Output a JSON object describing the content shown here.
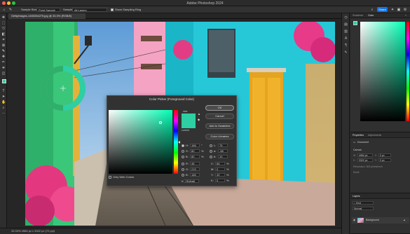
{
  "app": {
    "title": "Adobe Photoshop 2024"
  },
  "colors": {
    "foreground": "#2ecfa2",
    "accent": "#1473e6"
  },
  "options_bar": {
    "sample_size_label": "Sample Size:",
    "sample_size_value": "Point Sample",
    "sample_label": "Sample:",
    "sample_value": "All Layers",
    "show_ring_label": "Show Sampling Ring",
    "share_label": "Share"
  },
  "document": {
    "tab_label": "GettyImages-1483334275.jpg @ 33.3% (RGB/8)"
  },
  "status_bar": {
    "text": "33.33%   4984 px x 3322 px (72 ppi)"
  },
  "color_picker": {
    "title": "Color Picker (Foreground Color)",
    "new_label": "new",
    "current_label": "current",
    "ok_label": "OK",
    "cancel_label": "Cancel",
    "add_swatches_label": "Add to Swatches",
    "libraries_label": "Color Libraries",
    "only_web_colors_label": "Only Web Colors",
    "fields": {
      "h": {
        "label": "H:",
        "value": "166",
        "unit": "°"
      },
      "s": {
        "label": "S:",
        "value": "80",
        "unit": "%"
      },
      "b": {
        "label": "B:",
        "value": "80",
        "unit": "%"
      },
      "r": {
        "label": "R:",
        "value": "46",
        "unit": ""
      },
      "g": {
        "label": "G:",
        "value": "219",
        "unit": ""
      },
      "bl": {
        "label": "B:",
        "value": "166",
        "unit": ""
      },
      "l": {
        "label": "L:",
        "value": "76",
        "unit": ""
      },
      "a": {
        "label": "a:",
        "value": "-58",
        "unit": ""
      },
      "bb": {
        "label": "b:",
        "value": "10",
        "unit": ""
      },
      "c": {
        "label": "C:",
        "value": "66",
        "unit": "%"
      },
      "m": {
        "label": "M:",
        "value": "0",
        "unit": "%"
      },
      "y": {
        "label": "Y:",
        "value": "49",
        "unit": "%"
      },
      "k": {
        "label": "K:",
        "value": "0",
        "unit": "%"
      }
    },
    "hex_label": "#",
    "hex_value": "2Edba6"
  },
  "right_panels": {
    "color_tabs": [
      "Swatches",
      "Color"
    ],
    "properties_tabs": [
      "Properties",
      "Adjustments"
    ],
    "properties_doc": "Document",
    "canvas_label": "Canvas",
    "canvas_w": "4984 px",
    "canvas_h": "3322 px",
    "canvas_x": "0 px",
    "canvas_y": "0 px",
    "resolution": "Resolution: 300 pixels/inch",
    "mode": "Mode",
    "layers_tab": "Layers",
    "layer_name": "Background"
  }
}
